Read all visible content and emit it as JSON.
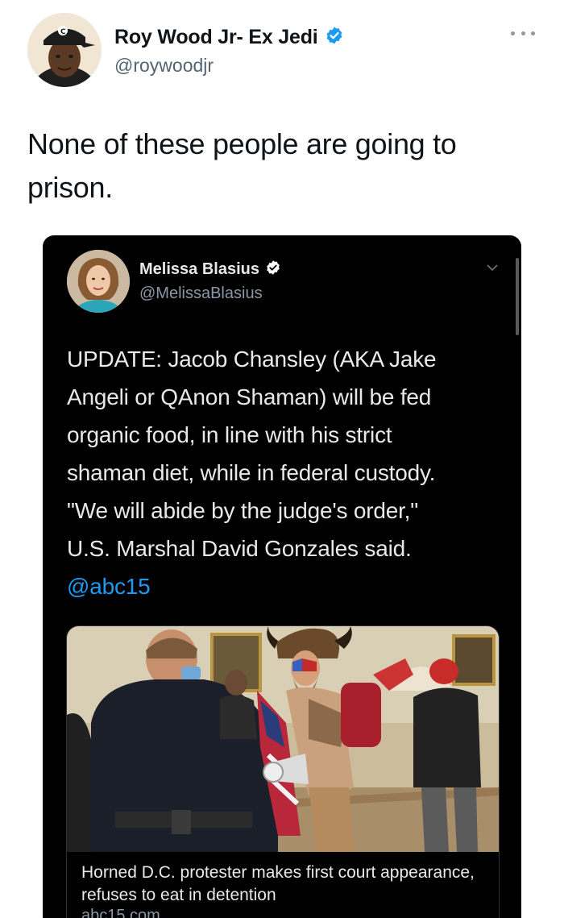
{
  "tweet": {
    "author_name": "Roy Wood Jr- Ex Jedi",
    "author_handle": "@roywoodjr",
    "text": "None of these people are going to prison.",
    "verified_icon": "verified-badge-icon",
    "more_icon": "more-options-icon"
  },
  "quoted_screenshot": {
    "author_name": "Melissa Blasius",
    "author_handle": "@MelissaBlasius",
    "text_lines": [
      "UPDATE: Jacob Chansley (AKA Jake",
      "Angeli or QAnon Shaman) will be fed",
      "organic food, in line with his strict",
      "shaman diet, while in federal custody.",
      "\"We will abide by the judge's order,\"",
      "U.S. Marshal David Gonzales said."
    ],
    "mention": "@abc15",
    "card": {
      "caption": "Horned D.C. protester makes first court appearance, refuses to eat in detention",
      "domain": "abc15.com"
    }
  },
  "colors": {
    "link_blue": "#1d9bf0",
    "verified_blue": "#1d9bf0",
    "dark_bg": "#000000",
    "light_text": "#e7e9ea",
    "secondary_text": "#8b98a5"
  }
}
